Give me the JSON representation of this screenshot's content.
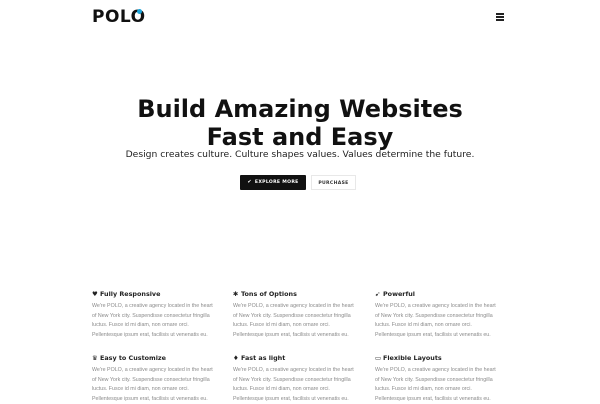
{
  "header": {
    "logo": "POLO",
    "menu_icon": "hamburger-menu-icon"
  },
  "hero": {
    "title_line1": "Build Amazing Websites",
    "title_line2": "Fast and Easy",
    "subtitle": "Design creates culture. Culture shapes values. Values determine the future.",
    "buttons": {
      "explore_label": "EXPLORE MORE",
      "explore_icon": "check-icon",
      "purchase_label": "PURCHASE"
    }
  },
  "colors": {
    "accent": "#1aa3d8",
    "dark": "#111111",
    "text_muted": "#8a8a8a"
  },
  "features": [
    {
      "title": "Fully Responsive",
      "icon": "heart-icon",
      "glyph": "♥",
      "lines": [
        "We're POLO, a creative agency located in the heart",
        "of New York city. Suspendisse consectetur fringilla",
        "luctus. Fusce id mi diam, non ornare orci.",
        "Pellentesque ipsum erat, facilisis ut venenatis eu."
      ]
    },
    {
      "title": "Tons of Options",
      "icon": "gear-icon",
      "glyph": "✱",
      "lines": [
        "We're POLO, a creative agency located in the heart",
        "of New York city. Suspendisse consectetur fringilla",
        "luctus. Fusce id mi diam, non ornare orci.",
        "Pellentesque ipsum erat, facilisis ut venenatis eu."
      ]
    },
    {
      "title": "Powerful",
      "icon": "rocket-icon",
      "glyph": "➹",
      "lines": [
        "We're POLO, a creative agency located in the heart",
        "of New York city. Suspendisse consectetur fringilla",
        "luctus. Fusce id mi diam, non ornare orci.",
        "Pellentesque ipsum erat, facilisis ut venenatis eu."
      ]
    },
    {
      "title": "Easy to Customize",
      "icon": "trophy-icon",
      "glyph": "♛",
      "lines": [
        "We're POLO, a creative agency located in the heart",
        "of New York city. Suspendisse consectetur fringilla",
        "luctus. Fusce id mi diam, non ornare orci.",
        "Pellentesque ipsum erat, facilisis ut venenatis eu."
      ]
    },
    {
      "title": "Fast as light",
      "icon": "lightbulb-icon",
      "glyph": "♦",
      "lines": [
        "We're POLO, a creative agency located in the heart",
        "of New York city. Suspendisse consectetur fringilla",
        "luctus. Fusce id mi diam, non ornare orci.",
        "Pellentesque ipsum erat, facilisis ut venenatis eu."
      ]
    },
    {
      "title": "Flexible Layouts",
      "icon": "desktop-icon",
      "glyph": "▭",
      "lines": [
        "We're POLO, a creative agency located in the heart",
        "of New York city. Suspendisse consectetur fringilla",
        "luctus. Fusce id mi diam, non ornare orci.",
        "Pellentesque ipsum erat, facilisis ut venenatis eu."
      ]
    }
  ]
}
